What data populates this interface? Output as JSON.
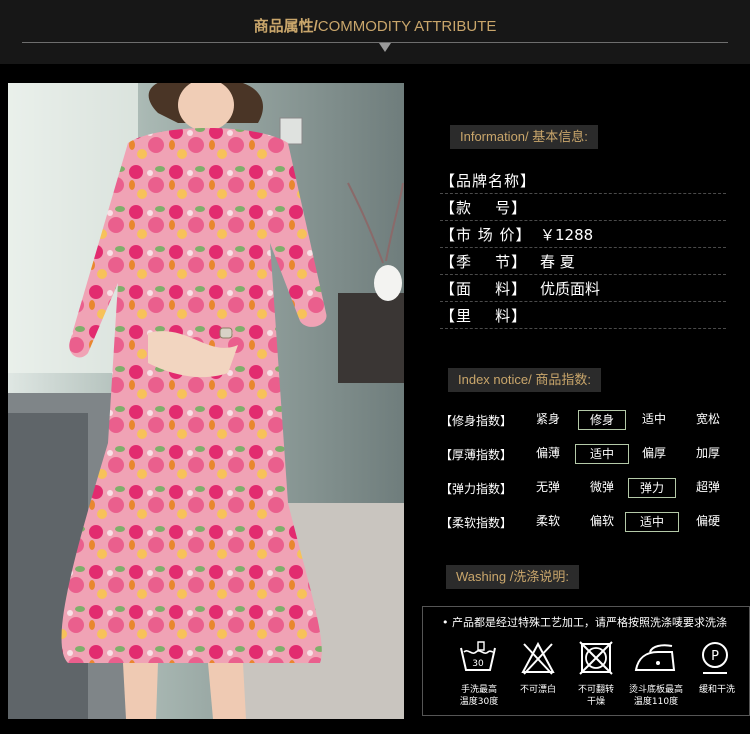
{
  "header": {
    "title_cn": "商品属性/",
    "title_en": "COMMODITY ATTRIBUTE"
  },
  "info": {
    "label": "Information/ 基本信息:",
    "rows": [
      {
        "key": "【品牌名称】",
        "value": ""
      },
      {
        "key": "【款    号】",
        "value": ""
      },
      {
        "key": "【市 场 价】",
        "value": "￥1288"
      },
      {
        "key": "【季    节】",
        "value": "春 夏"
      },
      {
        "key": "【面    料】",
        "value": "优质面料"
      },
      {
        "key": "【里    料】",
        "value": ""
      }
    ]
  },
  "index": {
    "label": "Index notice/ 商品指数:",
    "rows": [
      {
        "label": "【修身指数】",
        "options": [
          "紧身",
          "修身",
          "适中",
          "宽松"
        ],
        "selected": 1
      },
      {
        "label": "【厚薄指数】",
        "options": [
          "偏薄",
          "适中",
          "偏厚",
          "加厚"
        ],
        "selected": 1
      },
      {
        "label": "【弹力指数】",
        "options": [
          "无弹",
          "微弹",
          "弹力",
          "超弹"
        ],
        "selected": 2
      },
      {
        "label": "【柔软指数】",
        "options": [
          "柔软",
          "偏软",
          "适中",
          "偏硬"
        ],
        "selected": 2
      }
    ]
  },
  "washing": {
    "label": "Washing /洗涤说明:",
    "note": "• 产品都是经过特殊工艺加工，请严格按照洗涤唛要求洗涤",
    "icons": [
      {
        "icon": "hand-wash-30-icon",
        "mark": "30",
        "caption": [
          "手洗最高",
          "温度30度"
        ]
      },
      {
        "icon": "no-bleach-icon",
        "caption": [
          "不可漂白"
        ]
      },
      {
        "icon": "no-tumble-dry-icon",
        "caption": [
          "不可翻转",
          "干燥"
        ]
      },
      {
        "icon": "iron-110-icon",
        "caption": [
          "烫斗底板最高",
          "温度110度"
        ]
      },
      {
        "icon": "dry-clean-p-icon",
        "mark": "P",
        "caption": [
          "缓和干洗"
        ]
      }
    ]
  },
  "colors": {
    "accent": "#c9a66b",
    "selected_border": "#b4c9a8"
  }
}
